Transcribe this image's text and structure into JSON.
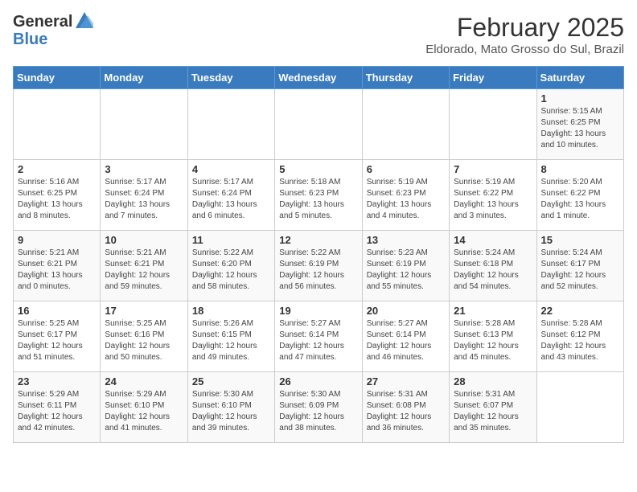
{
  "logo": {
    "general": "General",
    "blue": "Blue"
  },
  "title": "February 2025",
  "subtitle": "Eldorado, Mato Grosso do Sul, Brazil",
  "weekdays": [
    "Sunday",
    "Monday",
    "Tuesday",
    "Wednesday",
    "Thursday",
    "Friday",
    "Saturday"
  ],
  "weeks": [
    [
      {
        "day": "",
        "info": ""
      },
      {
        "day": "",
        "info": ""
      },
      {
        "day": "",
        "info": ""
      },
      {
        "day": "",
        "info": ""
      },
      {
        "day": "",
        "info": ""
      },
      {
        "day": "",
        "info": ""
      },
      {
        "day": "1",
        "info": "Sunrise: 5:15 AM\nSunset: 6:25 PM\nDaylight: 13 hours\nand 10 minutes."
      }
    ],
    [
      {
        "day": "2",
        "info": "Sunrise: 5:16 AM\nSunset: 6:25 PM\nDaylight: 13 hours\nand 8 minutes."
      },
      {
        "day": "3",
        "info": "Sunrise: 5:17 AM\nSunset: 6:24 PM\nDaylight: 13 hours\nand 7 minutes."
      },
      {
        "day": "4",
        "info": "Sunrise: 5:17 AM\nSunset: 6:24 PM\nDaylight: 13 hours\nand 6 minutes."
      },
      {
        "day": "5",
        "info": "Sunrise: 5:18 AM\nSunset: 6:23 PM\nDaylight: 13 hours\nand 5 minutes."
      },
      {
        "day": "6",
        "info": "Sunrise: 5:19 AM\nSunset: 6:23 PM\nDaylight: 13 hours\nand 4 minutes."
      },
      {
        "day": "7",
        "info": "Sunrise: 5:19 AM\nSunset: 6:22 PM\nDaylight: 13 hours\nand 3 minutes."
      },
      {
        "day": "8",
        "info": "Sunrise: 5:20 AM\nSunset: 6:22 PM\nDaylight: 13 hours\nand 1 minute."
      }
    ],
    [
      {
        "day": "9",
        "info": "Sunrise: 5:21 AM\nSunset: 6:21 PM\nDaylight: 13 hours\nand 0 minutes."
      },
      {
        "day": "10",
        "info": "Sunrise: 5:21 AM\nSunset: 6:21 PM\nDaylight: 12 hours\nand 59 minutes."
      },
      {
        "day": "11",
        "info": "Sunrise: 5:22 AM\nSunset: 6:20 PM\nDaylight: 12 hours\nand 58 minutes."
      },
      {
        "day": "12",
        "info": "Sunrise: 5:22 AM\nSunset: 6:19 PM\nDaylight: 12 hours\nand 56 minutes."
      },
      {
        "day": "13",
        "info": "Sunrise: 5:23 AM\nSunset: 6:19 PM\nDaylight: 12 hours\nand 55 minutes."
      },
      {
        "day": "14",
        "info": "Sunrise: 5:24 AM\nSunset: 6:18 PM\nDaylight: 12 hours\nand 54 minutes."
      },
      {
        "day": "15",
        "info": "Sunrise: 5:24 AM\nSunset: 6:17 PM\nDaylight: 12 hours\nand 52 minutes."
      }
    ],
    [
      {
        "day": "16",
        "info": "Sunrise: 5:25 AM\nSunset: 6:17 PM\nDaylight: 12 hours\nand 51 minutes."
      },
      {
        "day": "17",
        "info": "Sunrise: 5:25 AM\nSunset: 6:16 PM\nDaylight: 12 hours\nand 50 minutes."
      },
      {
        "day": "18",
        "info": "Sunrise: 5:26 AM\nSunset: 6:15 PM\nDaylight: 12 hours\nand 49 minutes."
      },
      {
        "day": "19",
        "info": "Sunrise: 5:27 AM\nSunset: 6:14 PM\nDaylight: 12 hours\nand 47 minutes."
      },
      {
        "day": "20",
        "info": "Sunrise: 5:27 AM\nSunset: 6:14 PM\nDaylight: 12 hours\nand 46 minutes."
      },
      {
        "day": "21",
        "info": "Sunrise: 5:28 AM\nSunset: 6:13 PM\nDaylight: 12 hours\nand 45 minutes."
      },
      {
        "day": "22",
        "info": "Sunrise: 5:28 AM\nSunset: 6:12 PM\nDaylight: 12 hours\nand 43 minutes."
      }
    ],
    [
      {
        "day": "23",
        "info": "Sunrise: 5:29 AM\nSunset: 6:11 PM\nDaylight: 12 hours\nand 42 minutes."
      },
      {
        "day": "24",
        "info": "Sunrise: 5:29 AM\nSunset: 6:10 PM\nDaylight: 12 hours\nand 41 minutes."
      },
      {
        "day": "25",
        "info": "Sunrise: 5:30 AM\nSunset: 6:10 PM\nDaylight: 12 hours\nand 39 minutes."
      },
      {
        "day": "26",
        "info": "Sunrise: 5:30 AM\nSunset: 6:09 PM\nDaylight: 12 hours\nand 38 minutes."
      },
      {
        "day": "27",
        "info": "Sunrise: 5:31 AM\nSunset: 6:08 PM\nDaylight: 12 hours\nand 36 minutes."
      },
      {
        "day": "28",
        "info": "Sunrise: 5:31 AM\nSunset: 6:07 PM\nDaylight: 12 hours\nand 35 minutes."
      },
      {
        "day": "",
        "info": ""
      }
    ]
  ]
}
